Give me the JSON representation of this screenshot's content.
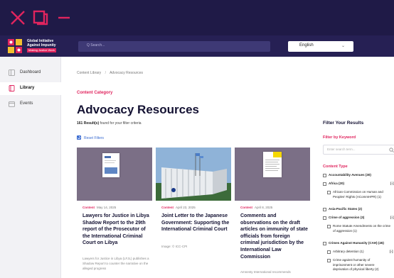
{
  "window": {
    "controls": [
      "close-icon",
      "maximize-icon",
      "minimize-icon"
    ]
  },
  "header": {
    "brand_line1": "Global Initiative",
    "brand_line2": "Against Impunity",
    "brand_tag": "Making Justice Work",
    "search_placeholder": "Q  Search...",
    "language": "English"
  },
  "sidebar": {
    "items": [
      {
        "label": "Dashboard",
        "icon": "dashboard-icon"
      },
      {
        "label": "Library",
        "icon": "library-icon",
        "active": true
      },
      {
        "label": "Events",
        "icon": "events-icon"
      }
    ]
  },
  "breadcrumb": {
    "items": [
      "Content Library",
      "/",
      "Advocacy Resources"
    ]
  },
  "page": {
    "category": "Content Category",
    "title": "Advocacy Resources",
    "results_count": "161 Result(s)",
    "results_suffix": " found for your filter criteria",
    "reset": "Reset Filters"
  },
  "cards": [
    {
      "type": "Content",
      "date": "May 14, 2025",
      "title": "Lawyers for Justice in Libya Shadow Report to the 29th report of the Prosecutor of the International Criminal Court on Libya",
      "sub": "Lawyers for Justice in Libya (LFJL) publishes a Shadow Report to counter the narrative on the alleged progress"
    },
    {
      "type": "Content",
      "date": "April 23, 2025",
      "title": "Joint Letter to the Japanese Government: Supporting the International Criminal Court",
      "sub": "Image: © ICC-CPI"
    },
    {
      "type": "Content",
      "date": "April 8, 2025",
      "title": "Comments and observations on the draft articles on immunity of state officials from foreign criminal jurisdiction by the International Law Commission",
      "sub": "Amnesty International recommends"
    }
  ],
  "filters": {
    "heading": "Filter Your Results",
    "keyword_label": "Filter by Keyword",
    "keyword_placeholder": "Enter search term...",
    "content_type_label": "Content Type",
    "options": [
      {
        "label": "Accountability Avenues (30)",
        "level": 0
      },
      {
        "label": "Africa (20)",
        "level": 0,
        "toggle": "[-]"
      },
      {
        "label": "African Commission on Human and Peoples' Rights (ACommHPR) (1)",
        "level": 1
      },
      {
        "label": "Asia-Pacific States (2)",
        "level": 0
      },
      {
        "label": "Crime of aggression (3)",
        "level": 0,
        "toggle": "[-]"
      },
      {
        "label": "Rome Statute Amendments on the crime of aggression (1)",
        "level": 1
      },
      {
        "label": "Crimes Against Humanity (CAH) (45)",
        "level": 0
      },
      {
        "label": "Arbitrary detention (1)",
        "level": 1,
        "toggle": "[-]"
      },
      {
        "label": "Crime against humanity of imprisonment or other severe deprivation of physical liberty (2)",
        "level": 1
      }
    ]
  },
  "colors": {
    "accent": "#e0245e",
    "navy": "#1f1a47",
    "link": "#3b6cd1"
  }
}
